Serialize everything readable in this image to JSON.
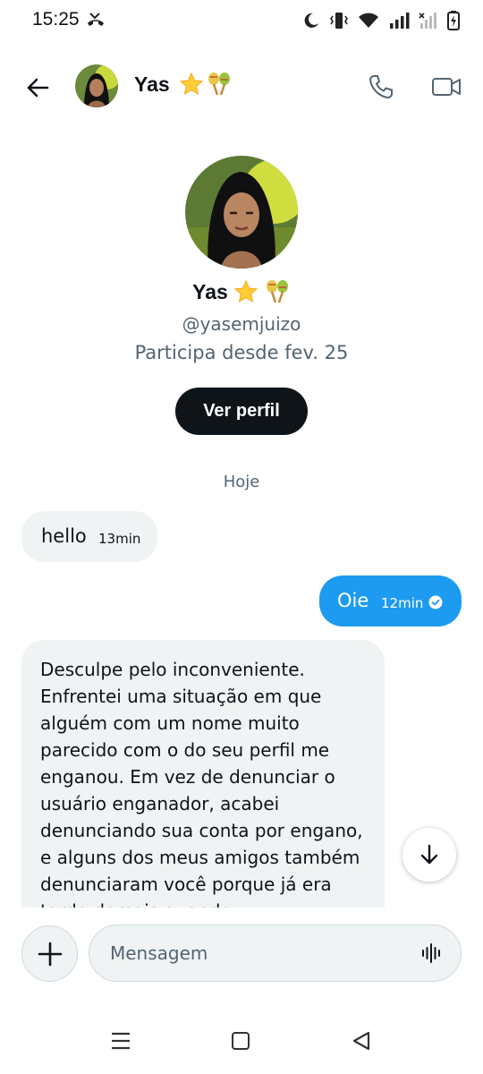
{
  "status": {
    "time": "15:25",
    "icons": [
      "missed-call-icon",
      "moon-icon",
      "vibrate-icon",
      "wifi-icon",
      "signal-icon",
      "signal-no-sim-icon",
      "battery-charging-icon"
    ]
  },
  "header": {
    "name": "Yas",
    "name_emoji": [
      "star-emoji",
      "maracas-emoji"
    ],
    "icons": [
      "back-arrow-icon",
      "phone-icon",
      "video-icon"
    ]
  },
  "profile": {
    "name": "Yas",
    "handle": "@yasemjuizo",
    "since": "Participa desde fev. 25",
    "button_label": "Ver perfil"
  },
  "conversation": {
    "date_separator": "Hoje",
    "messages": [
      {
        "direction": "in",
        "text": "hello",
        "time": "13min"
      },
      {
        "direction": "out",
        "text": "Oie",
        "time": "12min",
        "status": "read"
      },
      {
        "direction": "in",
        "text": "Desculpe pelo inconveniente. Enfrentei uma situação em que alguém com um nome muito parecido com o do seu perfil me enganou. Em vez de denunciar o usuário enganador, acabei denunciando sua conta por engano, e alguns dos meus amigos também denunciaram você porque já era tarde demais quando"
      }
    ]
  },
  "composer": {
    "placeholder": "Mensagem"
  },
  "colors": {
    "accent": "#1d9bf0",
    "incoming_bubble": "#eff3f4",
    "button_dark": "#0f1419",
    "secondary_text": "#536471"
  }
}
